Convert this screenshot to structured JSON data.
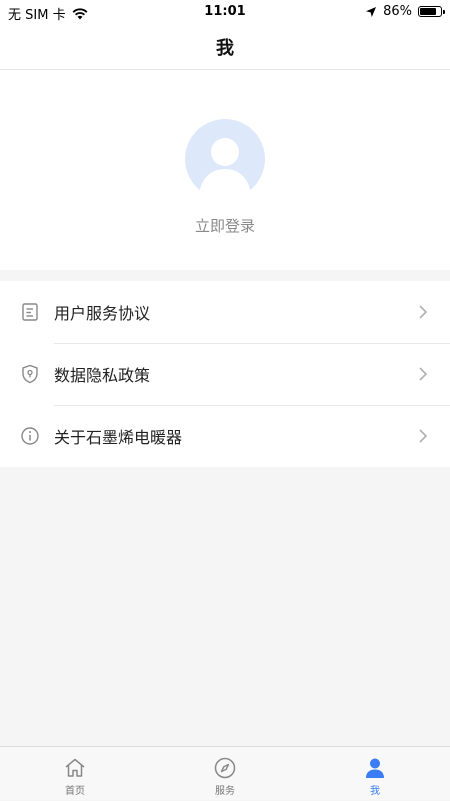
{
  "status_bar": {
    "carrier": "无 SIM 卡",
    "time": "11:01",
    "battery": "86%",
    "battery_level": 0.86
  },
  "nav": {
    "title": "我"
  },
  "profile": {
    "login_label": "立即登录"
  },
  "menu": {
    "items": [
      {
        "label": "用户服务协议",
        "icon": "document-icon"
      },
      {
        "label": "数据隐私政策",
        "icon": "shield-lock-icon"
      },
      {
        "label": "关于石墨烯电暖器",
        "icon": "info-icon"
      }
    ]
  },
  "tabs": [
    {
      "label": "首页",
      "icon": "home-icon",
      "active": false
    },
    {
      "label": "服务",
      "icon": "compass-icon",
      "active": false
    },
    {
      "label": "我",
      "icon": "person-icon",
      "active": true
    }
  ],
  "colors": {
    "accent": "#3a7df4",
    "avatar_bg": "#dde9fb",
    "page_bg": "#f5f5f5"
  }
}
